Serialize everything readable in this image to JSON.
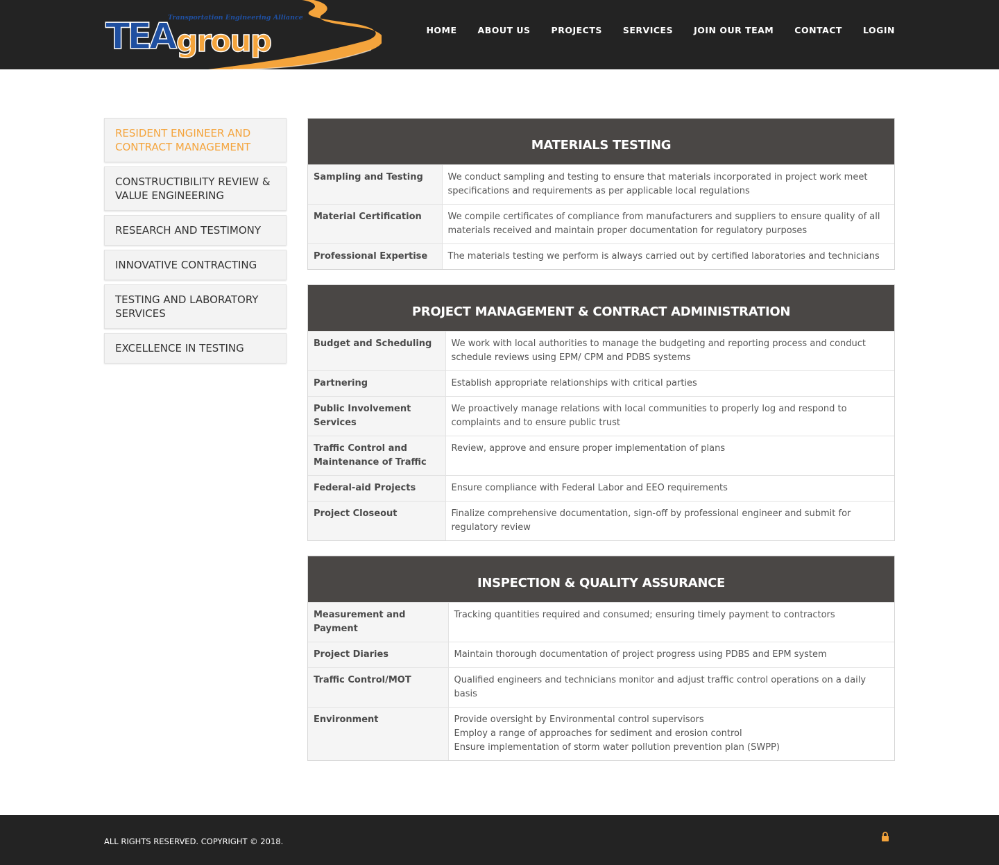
{
  "header": {
    "logo_text": "TEAgroup",
    "logo_tagline": "Transportation Engineering Alliance",
    "nav": [
      "HOME",
      "ABOUT US",
      "PROJECTS",
      "SERVICES",
      "JOIN OUR TEAM",
      "CONTACT",
      "LOGIN"
    ]
  },
  "sidebar": {
    "items": [
      {
        "label": "RESIDENT ENGINEER AND CONTRACT MANAGEMENT",
        "active": true
      },
      {
        "label": "CONSTRUCTIBILITY REVIEW & VALUE ENGINEERING",
        "active": false
      },
      {
        "label": "RESEARCH AND TESTIMONY",
        "active": false
      },
      {
        "label": "INNOVATIVE CONTRACTING",
        "active": false
      },
      {
        "label": "TESTING AND LABORATORY SERVICES",
        "active": false
      },
      {
        "label": "EXCELLENCE IN TESTING",
        "active": false
      }
    ]
  },
  "sections": [
    {
      "title": "MATERIALS TESTING",
      "rows": [
        {
          "label": "Sampling and Testing",
          "desc": [
            "We conduct sampling and testing to ensure that materials incorporated in project work meet specifications and requirements as per applicable local regulations"
          ]
        },
        {
          "label": "Material Certification",
          "desc": [
            "We compile certificates of compliance from manufacturers and suppliers to ensure quality of all materials received and maintain proper documentation for regulatory purposes"
          ]
        },
        {
          "label": "Professional Expertise",
          "desc": [
            "The materials testing we perform is always carried out by certified laboratories and technicians"
          ]
        }
      ]
    },
    {
      "title": "PROJECT MANAGEMENT & CONTRACT ADMINISTRATION",
      "rows": [
        {
          "label": "Budget and Scheduling",
          "desc": [
            "We work with local authorities to manage the budgeting and reporting process and conduct schedule reviews using EPM/ CPM and PDBS systems"
          ]
        },
        {
          "label": "Partnering",
          "desc": [
            "Establish appropriate relationships with critical parties"
          ]
        },
        {
          "label": "Public Involvement Services",
          "desc": [
            "We proactively manage relations with local communities to properly log and respond to complaints and to ensure public trust"
          ]
        },
        {
          "label": "Traffic Control and Maintenance of Traffic",
          "desc": [
            "Review, approve and ensure proper implementation of plans"
          ]
        },
        {
          "label": "Federal-aid Projects",
          "desc": [
            "Ensure compliance with Federal Labor and EEO requirements"
          ]
        },
        {
          "label": "Project Closeout",
          "desc": [
            "Finalize comprehensive documentation, sign-off by professional engineer and submit for regulatory review"
          ]
        }
      ]
    },
    {
      "title": "INSPECTION & QUALITY ASSURANCE",
      "rows": [
        {
          "label": "Measurement and Payment",
          "desc": [
            "Tracking quantities required and consumed; ensuring timely payment to contractors"
          ]
        },
        {
          "label": "Project Diaries",
          "desc": [
            "Maintain thorough documentation of project progress using PDBS and EPM system"
          ]
        },
        {
          "label": "Traffic Control/MOT",
          "desc": [
            "Qualified engineers and technicians monitor and adjust traffic control operations on a daily basis"
          ]
        },
        {
          "label": "Environment",
          "desc": [
            "Provide oversight by Environmental control supervisors",
            "Employ a range of approaches for sediment and erosion control",
            "Ensure implementation of storm water pollution prevention plan (SWPP)"
          ]
        }
      ]
    }
  ],
  "footer": {
    "copyright": "ALL RIGHTS RESERVED. COPYRIGHT © 2018."
  },
  "colors": {
    "accent": "#f4a43c",
    "header_bg": "#232323",
    "panel_head_bg": "#4a4745",
    "logo_blue": "#1f4fa0"
  }
}
